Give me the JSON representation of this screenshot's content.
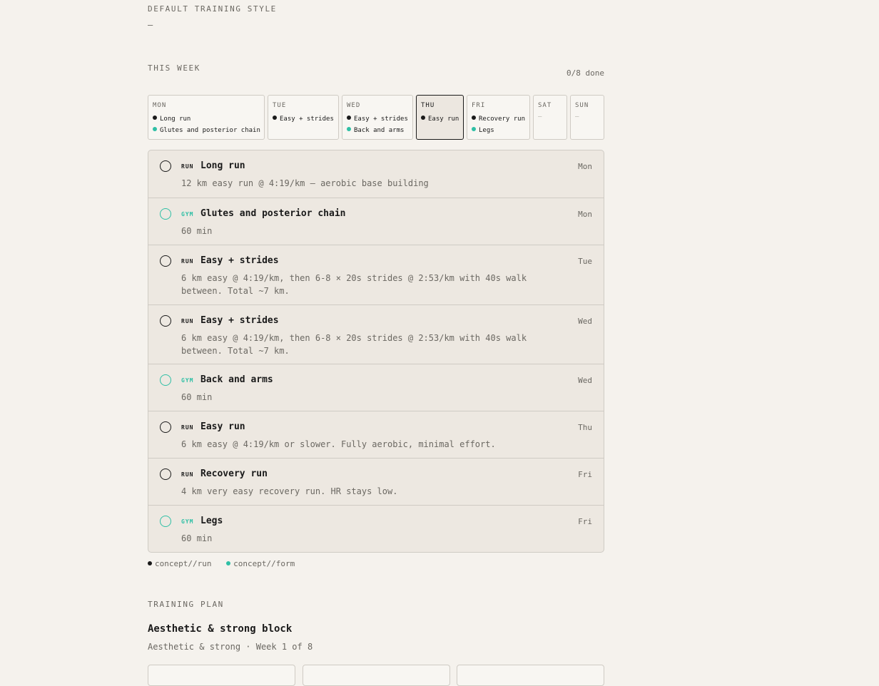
{
  "default_style": {
    "label": "DEFAULT TRAINING STYLE",
    "value": "—"
  },
  "week": {
    "label": "THIS WEEK",
    "done": "0/8 done",
    "days": [
      {
        "name": "MON",
        "items": [
          {
            "kind": "run",
            "text": "Long run"
          },
          {
            "kind": "gym",
            "text": "Glutes and posterior chain"
          }
        ]
      },
      {
        "name": "TUE",
        "items": [
          {
            "kind": "run",
            "text": "Easy + strides"
          }
        ]
      },
      {
        "name": "WED",
        "items": [
          {
            "kind": "run",
            "text": "Easy + strides"
          },
          {
            "kind": "gym",
            "text": "Back and arms"
          }
        ]
      },
      {
        "name": "THU",
        "items": [
          {
            "kind": "run",
            "text": "Easy run"
          }
        ],
        "active": true
      },
      {
        "name": "FRI",
        "items": [
          {
            "kind": "run",
            "text": "Recovery run"
          },
          {
            "kind": "gym",
            "text": "Legs"
          }
        ]
      },
      {
        "name": "SAT",
        "empty": "—"
      },
      {
        "name": "SUN",
        "empty": "—"
      }
    ]
  },
  "sessions": [
    {
      "kind": "run",
      "tag": "RUN",
      "title": "Long run",
      "desc": "12 km easy run @ 4:19/km — aerobic base building",
      "day": "Mon"
    },
    {
      "kind": "gym",
      "tag": "GYM",
      "title": "Glutes and posterior chain",
      "desc": "60 min",
      "day": "Mon"
    },
    {
      "kind": "run",
      "tag": "RUN",
      "title": "Easy + strides",
      "desc": "6 km easy @ 4:19/km, then 6-8 × 20s strides @ 2:53/km with 40s walk between. Total ~7 km.",
      "day": "Tue"
    },
    {
      "kind": "run",
      "tag": "RUN",
      "title": "Easy + strides",
      "desc": "6 km easy @ 4:19/km, then 6-8 × 20s strides @ 2:53/km with 40s walk between. Total ~7 km.",
      "day": "Wed"
    },
    {
      "kind": "gym",
      "tag": "GYM",
      "title": "Back and arms",
      "desc": "60 min",
      "day": "Wed"
    },
    {
      "kind": "run",
      "tag": "RUN",
      "title": "Easy run",
      "desc": "6 km easy @ 4:19/km or slower. Fully aerobic, minimal effort.",
      "day": "Thu"
    },
    {
      "kind": "run",
      "tag": "RUN",
      "title": "Recovery run",
      "desc": "4 km very easy recovery run. HR stays low.",
      "day": "Fri"
    },
    {
      "kind": "gym",
      "tag": "GYM",
      "title": "Legs",
      "desc": "60 min",
      "day": "Fri"
    }
  ],
  "legend": {
    "run": "concept//run",
    "gym": "concept//form"
  },
  "plan": {
    "label": "TRAINING PLAN",
    "title": "Aesthetic & strong block",
    "subtitle": "Aesthetic & strong · Week 1 of 8"
  },
  "colors": {
    "run": "#1a1a1a",
    "gym": "#2fbfa5",
    "background": "#f5f2ed"
  }
}
